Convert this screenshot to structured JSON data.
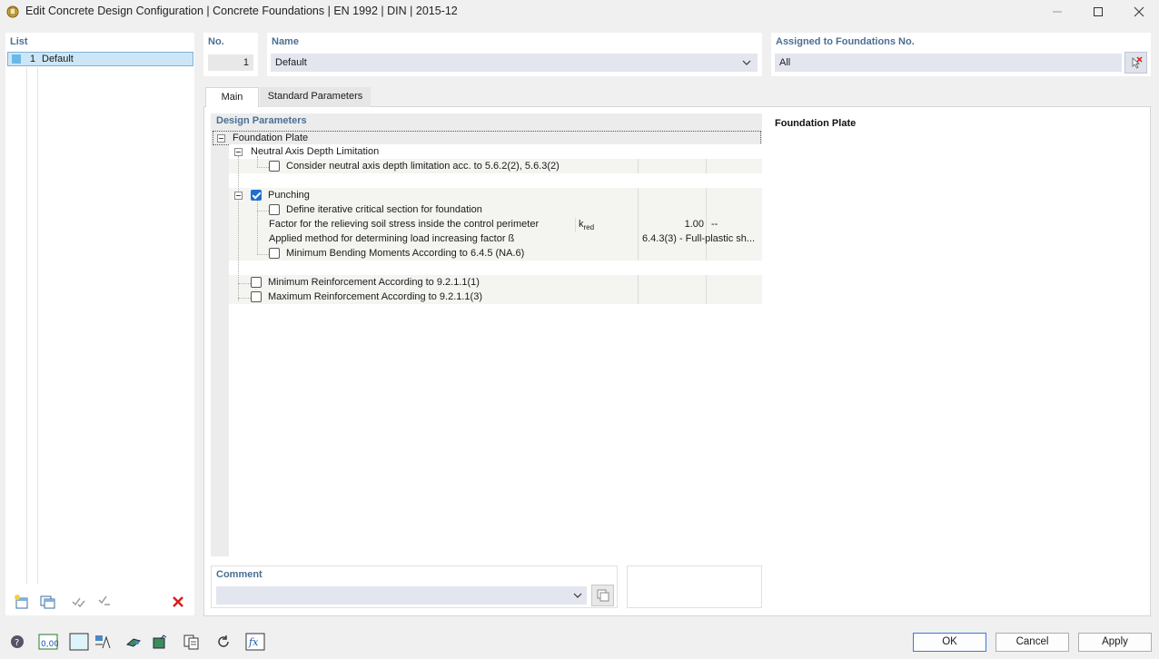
{
  "window": {
    "title": "Edit Concrete Design Configuration | Concrete Foundations | EN 1992 | DIN | 2015-12"
  },
  "list": {
    "label": "List",
    "items": [
      {
        "num": "1",
        "name": "Default"
      }
    ]
  },
  "header": {
    "no_label": "No.",
    "no_value": "1",
    "name_label": "Name",
    "name_value": "Default",
    "assigned_label": "Assigned to Foundations No.",
    "assigned_value": "All"
  },
  "tabs": [
    {
      "label": "Main",
      "active": true
    },
    {
      "label": "Standard Parameters",
      "active": false
    }
  ],
  "design_params": {
    "label": "Design Parameters",
    "root": "Foundation Plate",
    "neutral_axis": {
      "label": "Neutral Axis Depth Limitation",
      "consider": {
        "label": "Consider neutral axis depth limitation acc. to 5.6.2(2), 5.6.3(2)",
        "checked": false
      }
    },
    "punching": {
      "label": "Punching",
      "checked": true,
      "iterative": {
        "label": "Define iterative critical section for foundation",
        "checked": false
      },
      "factor": {
        "label": "Factor for the relieving soil stress inside the control perimeter",
        "symbol": "k",
        "symbol_sub": "red",
        "value": "1.00",
        "unit": "--"
      },
      "method": {
        "label": "Applied method for determining load increasing factor ß",
        "value": "6.4.3(3) - Full-plastic sh..."
      },
      "min_bending": {
        "label": "Minimum Bending Moments According to 6.4.5 (NA.6)",
        "checked": false
      }
    },
    "min_reinf": {
      "label": "Minimum Reinforcement According to 9.2.1.1(1)",
      "checked": false
    },
    "max_reinf": {
      "label": "Maximum Reinforcement According to 9.2.1.1(3)",
      "checked": false
    }
  },
  "info_panel": {
    "title": "Foundation Plate"
  },
  "comment": {
    "label": "Comment",
    "value": ""
  },
  "buttons": {
    "ok": "OK",
    "cancel": "Cancel",
    "apply": "Apply"
  },
  "bottom_icons": [
    "help-icon",
    "units-icon",
    "color-icon",
    "display-icon",
    "model-icon",
    "check-icon",
    "copy-icon",
    "reset-icon",
    "formula-icon"
  ]
}
